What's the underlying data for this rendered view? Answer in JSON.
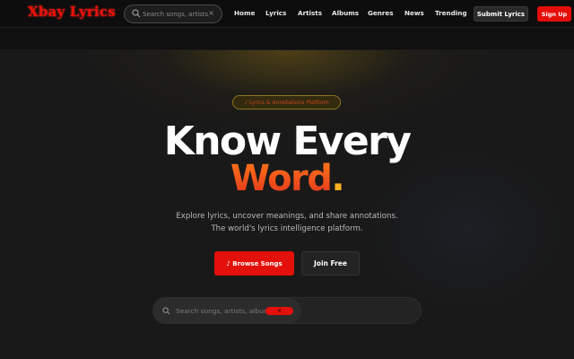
{
  "brand": {
    "name": "Xbay Lyrics",
    "color": "#e8100a"
  },
  "nav_search": {
    "placeholder": "Search songs, artists,...",
    "clear_icon": "×"
  },
  "nav": {
    "links": [
      "Home",
      "Lyrics",
      "Artists",
      "Albums",
      "Genres",
      "News",
      "Trending"
    ],
    "submit_label": "Submit Lyrics",
    "signup_label": "Sign Up"
  },
  "hero": {
    "tag": "♪ Lyrics & Annotations Platform",
    "headline_line1": "Know Every",
    "headline_word": "Word",
    "headline_dot": ".",
    "subtitle": "Explore lyrics, uncover meanings, and share annotations. The world's lyrics intelligence platform.",
    "browse_label": "♪ Browse Songs",
    "join_label": "Join Free"
  },
  "hero_search": {
    "placeholder": "Search songs, artists, albums...",
    "clear_icon": "×"
  },
  "colors": {
    "accent_red": "#e3100b",
    "gradient_orange": "#ff7a1a",
    "gold": "#ffb020"
  },
  "icons": {
    "search": "search-icon",
    "clear": "close-icon"
  }
}
